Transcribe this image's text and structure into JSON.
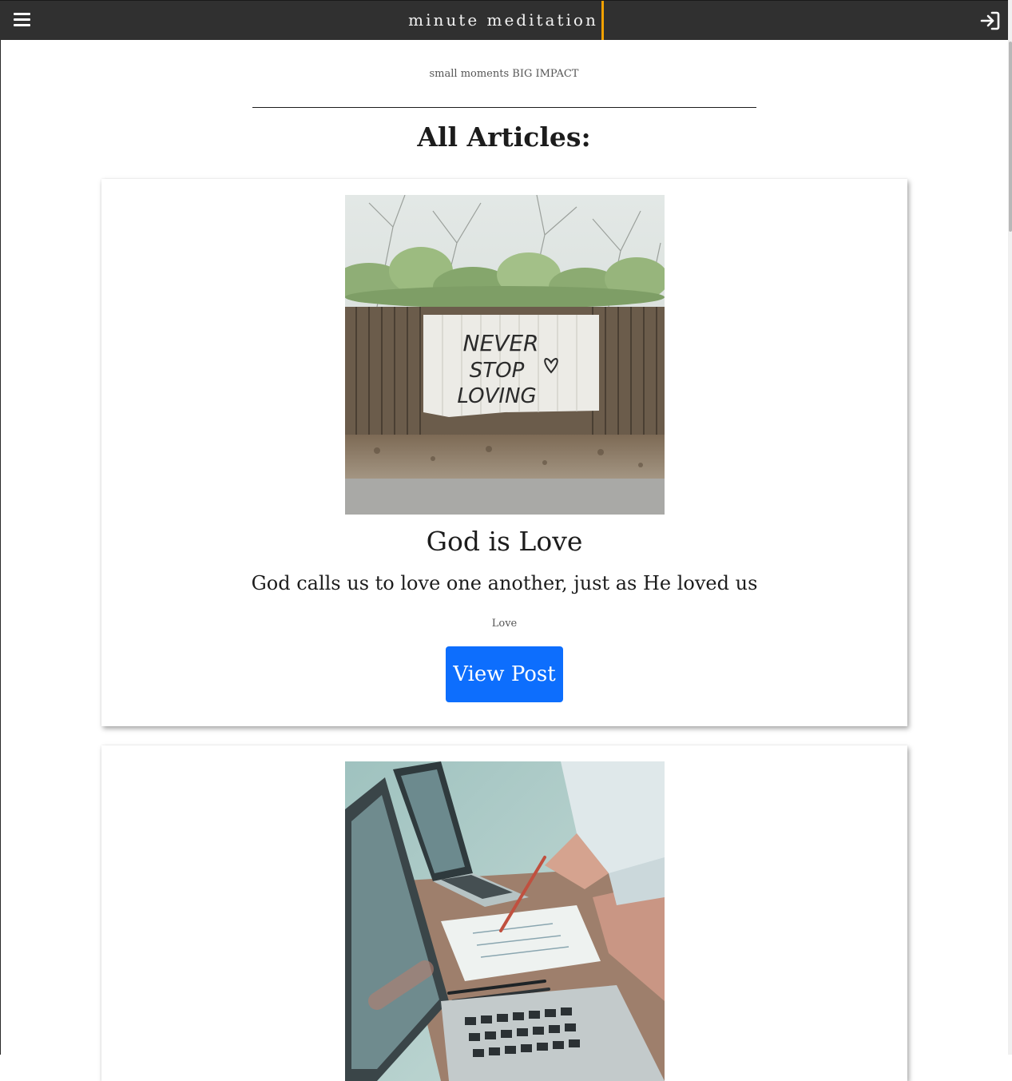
{
  "navbar": {
    "brand": "minute meditation",
    "menu_icon": "hamburger-menu-icon",
    "login_icon": "login-icon",
    "bar_color": "#303030",
    "caret_color": "#f2a100"
  },
  "header": {
    "tagline": "small moments BIG IMPACT",
    "section_title": "All Articles:"
  },
  "articles": [
    {
      "image": "wooden fence painted with graffiti text",
      "image_text": [
        "NEVER",
        "STOP",
        "LOVING"
      ],
      "title": "God is Love",
      "subtitle": "God calls us to love one another, just as He loved us",
      "tag": "Love",
      "button_label": "View Post"
    },
    {
      "image": "people working at laptops with notes"
    }
  ],
  "colors": {
    "button": "#0d6efd",
    "text": "#1c1c1c",
    "muted": "#555555"
  }
}
